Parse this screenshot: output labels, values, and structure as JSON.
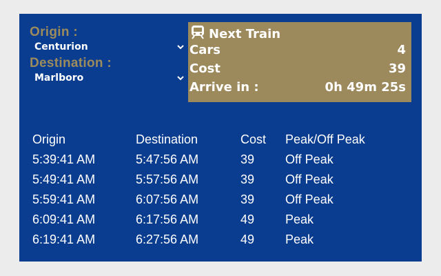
{
  "origin": {
    "label": "Origin :",
    "value": "Centurion"
  },
  "destination": {
    "label": "Destination :",
    "value": "Marlboro"
  },
  "next_train": {
    "title": "Next Train",
    "icon": "train-icon",
    "cars_label": "Cars",
    "cars_value": "4",
    "cost_label": "Cost",
    "cost_value": "39",
    "arrive_label": "Arrive in :",
    "arrive_value": "0h 49m 25s"
  },
  "schedule": {
    "headers": [
      "Origin",
      "Destination",
      "Cost",
      "Peak/Off Peak"
    ],
    "rows": [
      [
        "5:39:41 AM",
        "5:47:56 AM",
        "39",
        "Off Peak"
      ],
      [
        "5:49:41 AM",
        "5:57:56 AM",
        "39",
        "Off Peak"
      ],
      [
        "5:59:41 AM",
        "6:07:56 AM",
        "39",
        "Off Peak"
      ],
      [
        "6:09:41 AM",
        "6:17:56 AM",
        "49",
        "Peak"
      ],
      [
        "6:19:41 AM",
        "6:27:56 AM",
        "49",
        "Peak"
      ]
    ]
  },
  "colors": {
    "panel": "#0a3d8f",
    "accent": "#9c8a5c",
    "page": "#ececec"
  }
}
